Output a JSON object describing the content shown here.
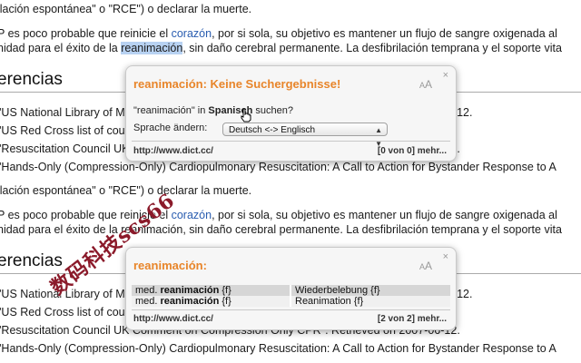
{
  "article": {
    "blocks": [
      {
        "line1": "ilación espontánea\" o \"RCE\") o declarar la muerte.",
        "line2_a": "P es poco probable que reinicie el ",
        "line2_link": "corazón",
        "line2_b": ", por si sola, su objetivo es mantener un flujo de sangre oxigenada al",
        "line3_a": "nidad para el éxito de la ",
        "line3_word": "reanimación",
        "line3_b": ", sin daño cerebral permanente. La desfibrilación temprana y el soporte vita",
        "heading": "erencias",
        "ref1": "\"US National Library of Medicine – Cardiopulmonary Resuscitation – Retrieved on 2007-06-12.",
        "ref2": "\"US Red Cross list of courses\". Retrieved on 2007-06-12.",
        "ref3": "\"Resuscitation Council UK Comment on Compression Only CPR\". Retrieved on 2007-06-12.",
        "ref4": "\"Hands-Only (Compression-Only) Cardiopulmonary Resuscitation: A Call to Action for Bystander Response to A"
      },
      {
        "line1": "ilación espontánea\" o \"RCE\") o declarar la muerte.",
        "line2_a": "P es poco probable que reinicie el ",
        "line2_link": "corazón",
        "line2_b": ", por si sola, su objetivo es mantener un flujo de sangre oxigenada al",
        "line3_a": "nidad para el éxito de la ",
        "line3_word": "reanimación",
        "line3_b": ", sin daño cerebral permanente. La desfibrilación temprana y el soporte vita",
        "heading": "erencias",
        "ref1": "\"US National Library of Medicine – Cardiopulmonary Resuscitation – Retrieved on 2007-06-12.",
        "ref2": "\"US Red Cross list of courses\". Retrieved on 2007-06-12.",
        "ref3": "\"Resuscitation Council UK Comment on Compression Only CPR\". Retrieved on 2007-06-12.",
        "ref4": "\"Hands-Only (Compression-Only) Cardiopulmonary Resuscitation: A Call to Action for Bystander Response to A"
      }
    ]
  },
  "popup1": {
    "title": "reanimación: Keine Suchergebnisse!",
    "aa": "A",
    "query_pre": "\"reanimación\" in ",
    "query_lang": "Spanisch",
    "query_post": " suchen?",
    "change_label": "Sprache ändern:",
    "select_value": "Deutsch <-> Englisch",
    "footer_url": "http://www.dict.cc/",
    "footer_count": "[0 von 0] mehr...",
    "close": "×"
  },
  "popup2": {
    "title": "reanimación:",
    "aa": "A",
    "rows": [
      {
        "prefix": "med. ",
        "term": "reanimación",
        "gender": " {f}",
        "translation": "Wiederbelebung {f}"
      },
      {
        "prefix": "med. ",
        "term": "reanimación",
        "gender": " {f}",
        "translation": "Reanimation {f}"
      }
    ],
    "footer_url": "http://www.dict.cc/",
    "footer_count": "[2 von 2] mehr...",
    "close": "×"
  },
  "watermark": "数码科技scs66",
  "colors": {
    "accent": "#e8852a",
    "link": "#2a5db0",
    "highlight": "#b8d2f2"
  }
}
